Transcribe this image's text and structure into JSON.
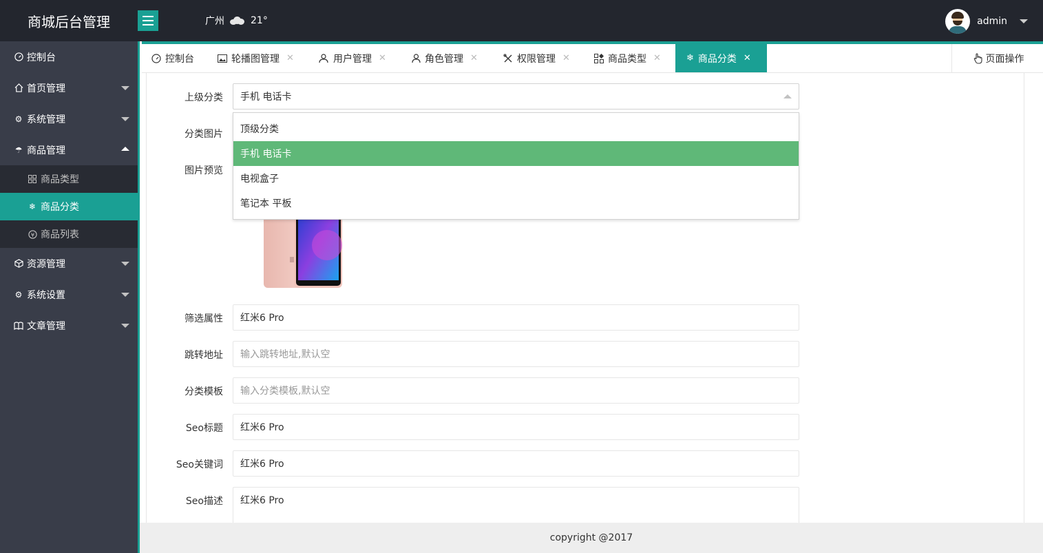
{
  "header": {
    "title": "商城后台管理",
    "city": "广州",
    "weather_icon": "cloud-icon",
    "temperature": "21°",
    "username": "admin"
  },
  "colors": {
    "header_bg": "#23262e",
    "sidebar_bg": "#393d49",
    "accent": "#1aa094",
    "selected_option": "#5fb878"
  },
  "sidebar": {
    "items": [
      {
        "label": "控制台",
        "icon": "dashboard-icon"
      },
      {
        "label": "首页管理",
        "icon": "home-icon"
      },
      {
        "label": "系统管理",
        "icon": "gear-icon"
      },
      {
        "label": "商品管理",
        "icon": "umbrella-icon",
        "expanded": true
      },
      {
        "label": "资源管理",
        "icon": "cube-icon"
      },
      {
        "label": "系统设置",
        "icon": "gear-icon"
      },
      {
        "label": "文章管理",
        "icon": "book-icon"
      }
    ],
    "sub_items": [
      {
        "label": "商品类型",
        "icon": "grid-icon"
      },
      {
        "label": "商品分类",
        "icon": "snowflake-icon",
        "active": true
      },
      {
        "label": "商品列表",
        "icon": "yen-icon"
      }
    ]
  },
  "tabs": [
    {
      "label": "控制台",
      "icon": "dashboard-icon",
      "closable": false
    },
    {
      "label": "轮播图管理",
      "icon": "image-icon",
      "closable": true
    },
    {
      "label": "用户管理",
      "icon": "users-icon",
      "closable": true
    },
    {
      "label": "角色管理",
      "icon": "user-icon",
      "closable": true
    },
    {
      "label": "权限管理",
      "icon": "tools-icon",
      "closable": true
    },
    {
      "label": "商品类型",
      "icon": "grid-icon",
      "closable": true
    },
    {
      "label": "商品分类",
      "icon": "snowflake-icon",
      "closable": true,
      "active": true
    }
  ],
  "page_ops_label": "页面操作",
  "form": {
    "parent_category": {
      "label": "上级分类",
      "value": "手机 电话卡",
      "options": [
        "顶级分类",
        "手机 电话卡",
        "电视盒子",
        "笔记本 平板"
      ]
    },
    "category_image": {
      "label": "分类图片"
    },
    "image_preview": {
      "label": "图片预览"
    },
    "filter_attr": {
      "label": "筛选属性",
      "value": "红米6 Pro"
    },
    "redirect_url": {
      "label": "跳转地址",
      "placeholder": "输入跳转地址,默认空"
    },
    "category_template": {
      "label": "分类模板",
      "placeholder": "输入分类模板,默认空"
    },
    "seo_title": {
      "label": "Seo标题",
      "value": "红米6 Pro"
    },
    "seo_keywords": {
      "label": "Seo关键词",
      "value": "红米6 Pro"
    },
    "seo_description": {
      "label": "Seo描述",
      "value": "红米6 Pro"
    }
  },
  "footer": {
    "text": "copyright @2017"
  }
}
